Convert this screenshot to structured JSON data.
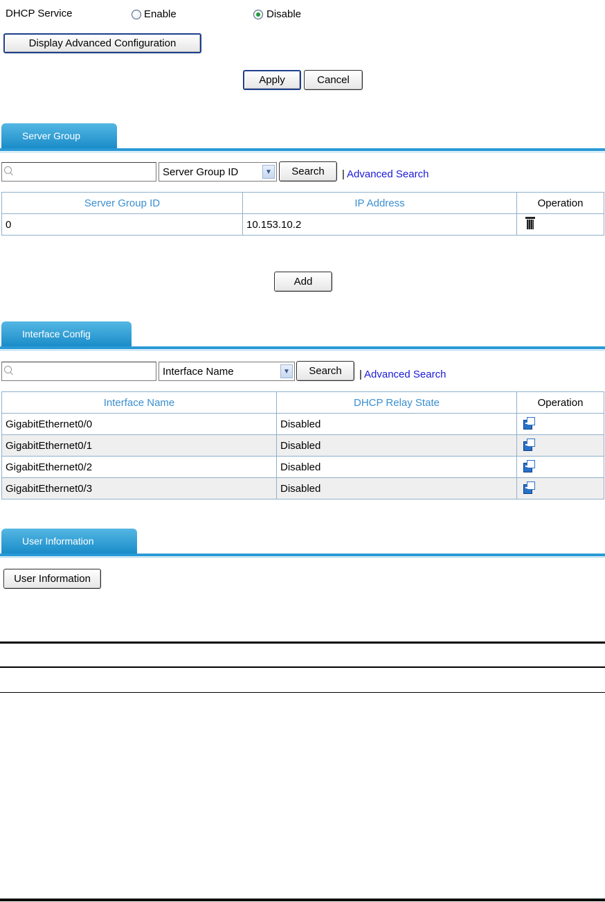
{
  "dhcp": {
    "label": "DHCP Service",
    "enable_label": "Enable",
    "disable_label": "Disable",
    "selected": "Disable",
    "advanced_button": "Display Advanced Configuration",
    "apply_button": "Apply",
    "cancel_button": "Cancel"
  },
  "server_group": {
    "tab_label": "Server Group",
    "search_placeholder": "",
    "search_field": "Server Group ID",
    "search_button": "Search",
    "separator": "|",
    "advanced_search": "Advanced Search",
    "columns": [
      "Server Group ID",
      "IP Address",
      "Operation"
    ],
    "rows": [
      {
        "id": "0",
        "ip": "10.153.10.2",
        "operation_icon": "delete-icon"
      }
    ],
    "add_button": "Add"
  },
  "interface_config": {
    "tab_label": "Interface Config",
    "search_field": "Interface Name",
    "search_button": "Search",
    "separator": "|",
    "advanced_search": "Advanced Search",
    "columns": [
      "Interface Name",
      "DHCP Relay State",
      "Operation"
    ],
    "rows": [
      {
        "name": "GigabitEthernet0/0",
        "state": "Disabled",
        "operation_icon": "configure-icon"
      },
      {
        "name": "GigabitEthernet0/1",
        "state": "Disabled",
        "operation_icon": "configure-icon"
      },
      {
        "name": "GigabitEthernet0/2",
        "state": "Disabled",
        "operation_icon": "configure-icon"
      },
      {
        "name": "GigabitEthernet0/3",
        "state": "Disabled",
        "operation_icon": "configure-icon"
      }
    ]
  },
  "user_information": {
    "tab_label": "User Information",
    "button": "User Information"
  },
  "colors": {
    "tab": "#1a8cc9",
    "link": "#1a1ad6",
    "header_text": "#3a8fd0",
    "radio_checked": "#1e9a3a"
  }
}
